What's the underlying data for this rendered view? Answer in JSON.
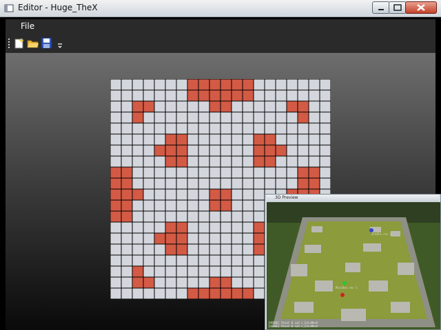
{
  "window": {
    "title": "Editor - Huge_TheX",
    "controls": [
      "minimize",
      "maximize",
      "close"
    ]
  },
  "menubar": {
    "items": [
      "File"
    ]
  },
  "toolbar": {
    "buttons": [
      "new-map-icon",
      "open-folder-icon",
      "save-disk-icon"
    ]
  },
  "grid": {
    "rows": 20,
    "cols": 20,
    "colors": {
      "empty": "#d3d6dc",
      "wall": "#d35a45",
      "line": "#000000"
    },
    "walls": [
      "0000000111111000000",
      "0000000111111000000",
      "0011000001100000110",
      "0010000000000000010",
      "0000000000000000000",
      "0000011000000110000",
      "0000111000000111000",
      "0000011000000110000",
      "1100000000000000011",
      "1100000000000000011",
      "1110000001100000111",
      "1100000001100000011",
      "1100000000000000011",
      "0000011000000110000",
      "0000111000000111000",
      "0000011000000110000",
      "0000000000000000000",
      "0010000000000000010",
      "0011000001100000110",
      "0000000111111000000"
    ]
  },
  "preview": {
    "title": "3D Preview",
    "overlay": [
      "Zindle.rev 2",
      "MiniOne.rev 1"
    ],
    "console": [
      "[DEBUG] Point 8 sa3 s_CalcMesh",
      "[DEBUG] Point 8 sa3 s_CalcMesh"
    ]
  }
}
